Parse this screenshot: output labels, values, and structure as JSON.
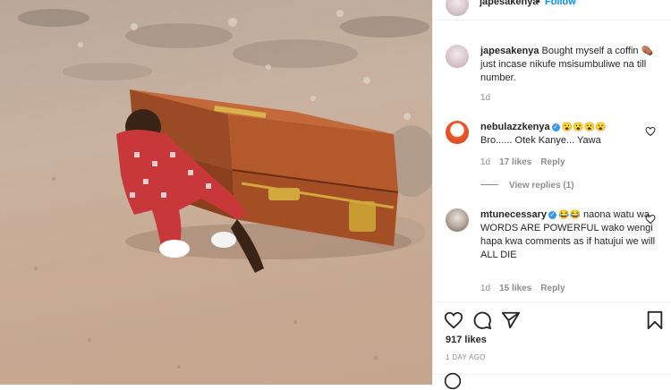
{
  "post": {
    "author": "japesakenya",
    "follow_label": "Follow",
    "separator": "•",
    "caption": "Bought myself a coffin ⚰️ just incase nikufe msisumbuliwe na till number.",
    "caption_age": "1d",
    "likes": "917 likes",
    "time_ago": "1 DAY AGO"
  },
  "comments": [
    {
      "user": "nebulazzkenya",
      "verified": true,
      "emojis": "😮😮😮😮",
      "text": "Bro...... Otek Kanye... Yawa",
      "age": "1d",
      "likes": "17 likes",
      "reply_label": "Reply",
      "view_replies": "View replies (1)"
    },
    {
      "user": "mtunecessary",
      "verified": true,
      "emojis": "😂😂",
      "text": "naona watu wa WORDS ARE POWERFUL wako wengi hapa kwa comments as if hatujui we will ALL DIE",
      "age": "1d",
      "likes": "15 likes",
      "reply_label": "Reply"
    }
  ],
  "icons": {
    "like": "heart-icon",
    "comment": "comment-icon",
    "share": "paper-plane-icon",
    "save": "bookmark-icon"
  },
  "colors": {
    "link_blue": "#0095f6",
    "verified_blue": "#3897f0",
    "muted_text": "#8e8e8e",
    "primary_text": "#262626"
  }
}
